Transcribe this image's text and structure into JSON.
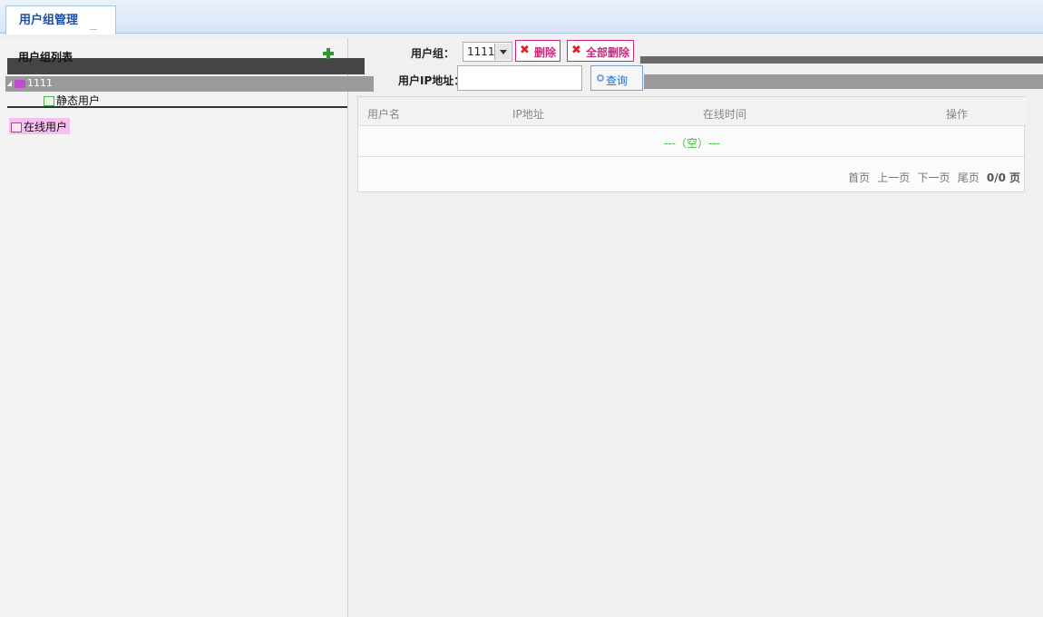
{
  "tabs": [
    {
      "label": "用户组管理"
    }
  ],
  "sidebar": {
    "title": "用户组列表",
    "root": {
      "label": "1111"
    },
    "items": [
      {
        "label": "静态用户"
      },
      {
        "label": "在线用户"
      }
    ]
  },
  "filters": {
    "group_label": "用户组：",
    "group_value": "1111",
    "delete_label": "删除",
    "delete_all_label": "全部删除",
    "ip_label": "用户IP地址：",
    "ip_value": "",
    "query_label": "查询"
  },
  "table": {
    "columns": [
      "用户名",
      "IP地址",
      "在线时间",
      "操作"
    ],
    "empty_text": "---（空）---",
    "pager": {
      "first": "首页",
      "prev": "上一页",
      "next": "下一页",
      "last": "尾页",
      "info": "0/0",
      "unit": "页"
    }
  },
  "colors": {
    "accent": "#1c4fa8",
    "danger": "#c8277e",
    "empty": "#3bbf3b"
  }
}
